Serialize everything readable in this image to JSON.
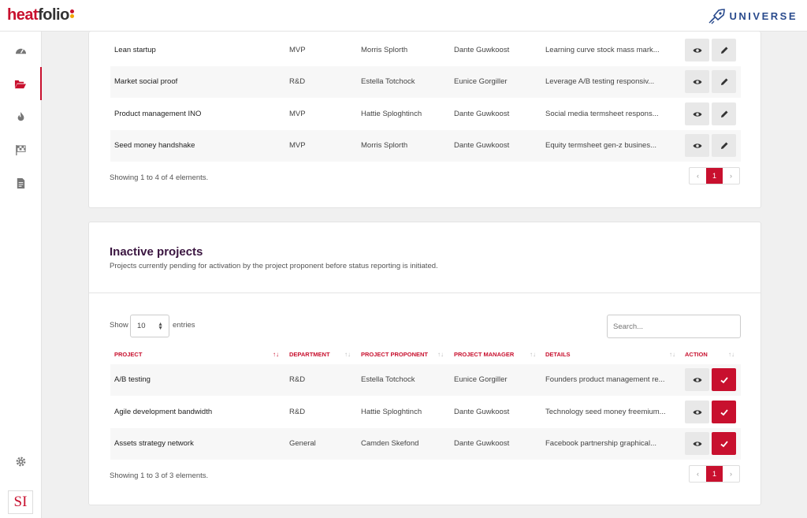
{
  "header": {
    "logo_text_red": "heat",
    "logo_text_dark": "foli",
    "logo_text_end": "o",
    "logo_dot_colors": [
      "#c8102e",
      "#f0a500",
      "#3aa655"
    ],
    "brand_right": "UNIVERSE"
  },
  "sidebar": {
    "items": [
      {
        "icon": "dashboard-icon",
        "active": false
      },
      {
        "icon": "folder-open-icon",
        "active": true
      },
      {
        "icon": "fire-icon",
        "active": false
      },
      {
        "icon": "checkered-flag-icon",
        "active": false
      },
      {
        "icon": "document-icon",
        "active": false
      }
    ],
    "settings_icon": "gear-icon",
    "footer_logo": "SI"
  },
  "active_projects": {
    "rows": [
      {
        "project": "Lean startup",
        "department": "MVP",
        "proponent": "Morris Splorth",
        "manager": "Dante Guwkoost",
        "details": "Learning curve stock mass mark..."
      },
      {
        "project": "Market social proof",
        "department": "R&D",
        "proponent": "Estella Totchock",
        "manager": "Eunice Gorgiller",
        "details": "Leverage A/B testing responsiv..."
      },
      {
        "project": "Product management INO",
        "department": "MVP",
        "proponent": "Hattie Sploghtinch",
        "manager": "Dante Guwkoost",
        "details": "Social media termsheet respons..."
      },
      {
        "project": "Seed money handshake",
        "department": "MVP",
        "proponent": "Morris Splorth",
        "manager": "Dante Guwkoost",
        "details": "Equity termsheet gen-z busines..."
      }
    ],
    "showing": "Showing 1 to 4 of 4 elements.",
    "pagination": {
      "prev": "‹",
      "page": "1",
      "next": "›"
    }
  },
  "inactive_projects": {
    "title": "Inactive projects",
    "subtitle": "Projects currently pending for activation by the project proponent before status reporting is initiated.",
    "show_label": "Show",
    "entries_value": "10",
    "entries_label": "entries",
    "search_placeholder": "Search...",
    "columns": [
      "PROJECT",
      "DEPARTMENT",
      "PROJECT PROPONENT",
      "PROJECT MANAGER",
      "DETAILS",
      "ACTION"
    ],
    "sort_icons": {
      "active": "↑↓",
      "inactive": "↑↓"
    },
    "rows": [
      {
        "project": "A/B testing",
        "department": "R&D",
        "proponent": "Estella Totchock",
        "manager": "Eunice Gorgiller",
        "details": "Founders product management re..."
      },
      {
        "project": "Agile development bandwidth",
        "department": "R&D",
        "proponent": "Hattie Sploghtinch",
        "manager": "Dante Guwkoost",
        "details": "Technology seed money freemium..."
      },
      {
        "project": "Assets strategy network",
        "department": "General",
        "proponent": "Camden Skefond",
        "manager": "Dante Guwkoost",
        "details": "Facebook partnership graphical..."
      }
    ],
    "showing": "Showing 1 to 3 of 3 elements.",
    "pagination": {
      "prev": "‹",
      "page": "1",
      "next": "›"
    }
  },
  "colors": {
    "accent": "#c8102e",
    "title": "#3a1540",
    "brand_blue": "#2a4b8d"
  }
}
